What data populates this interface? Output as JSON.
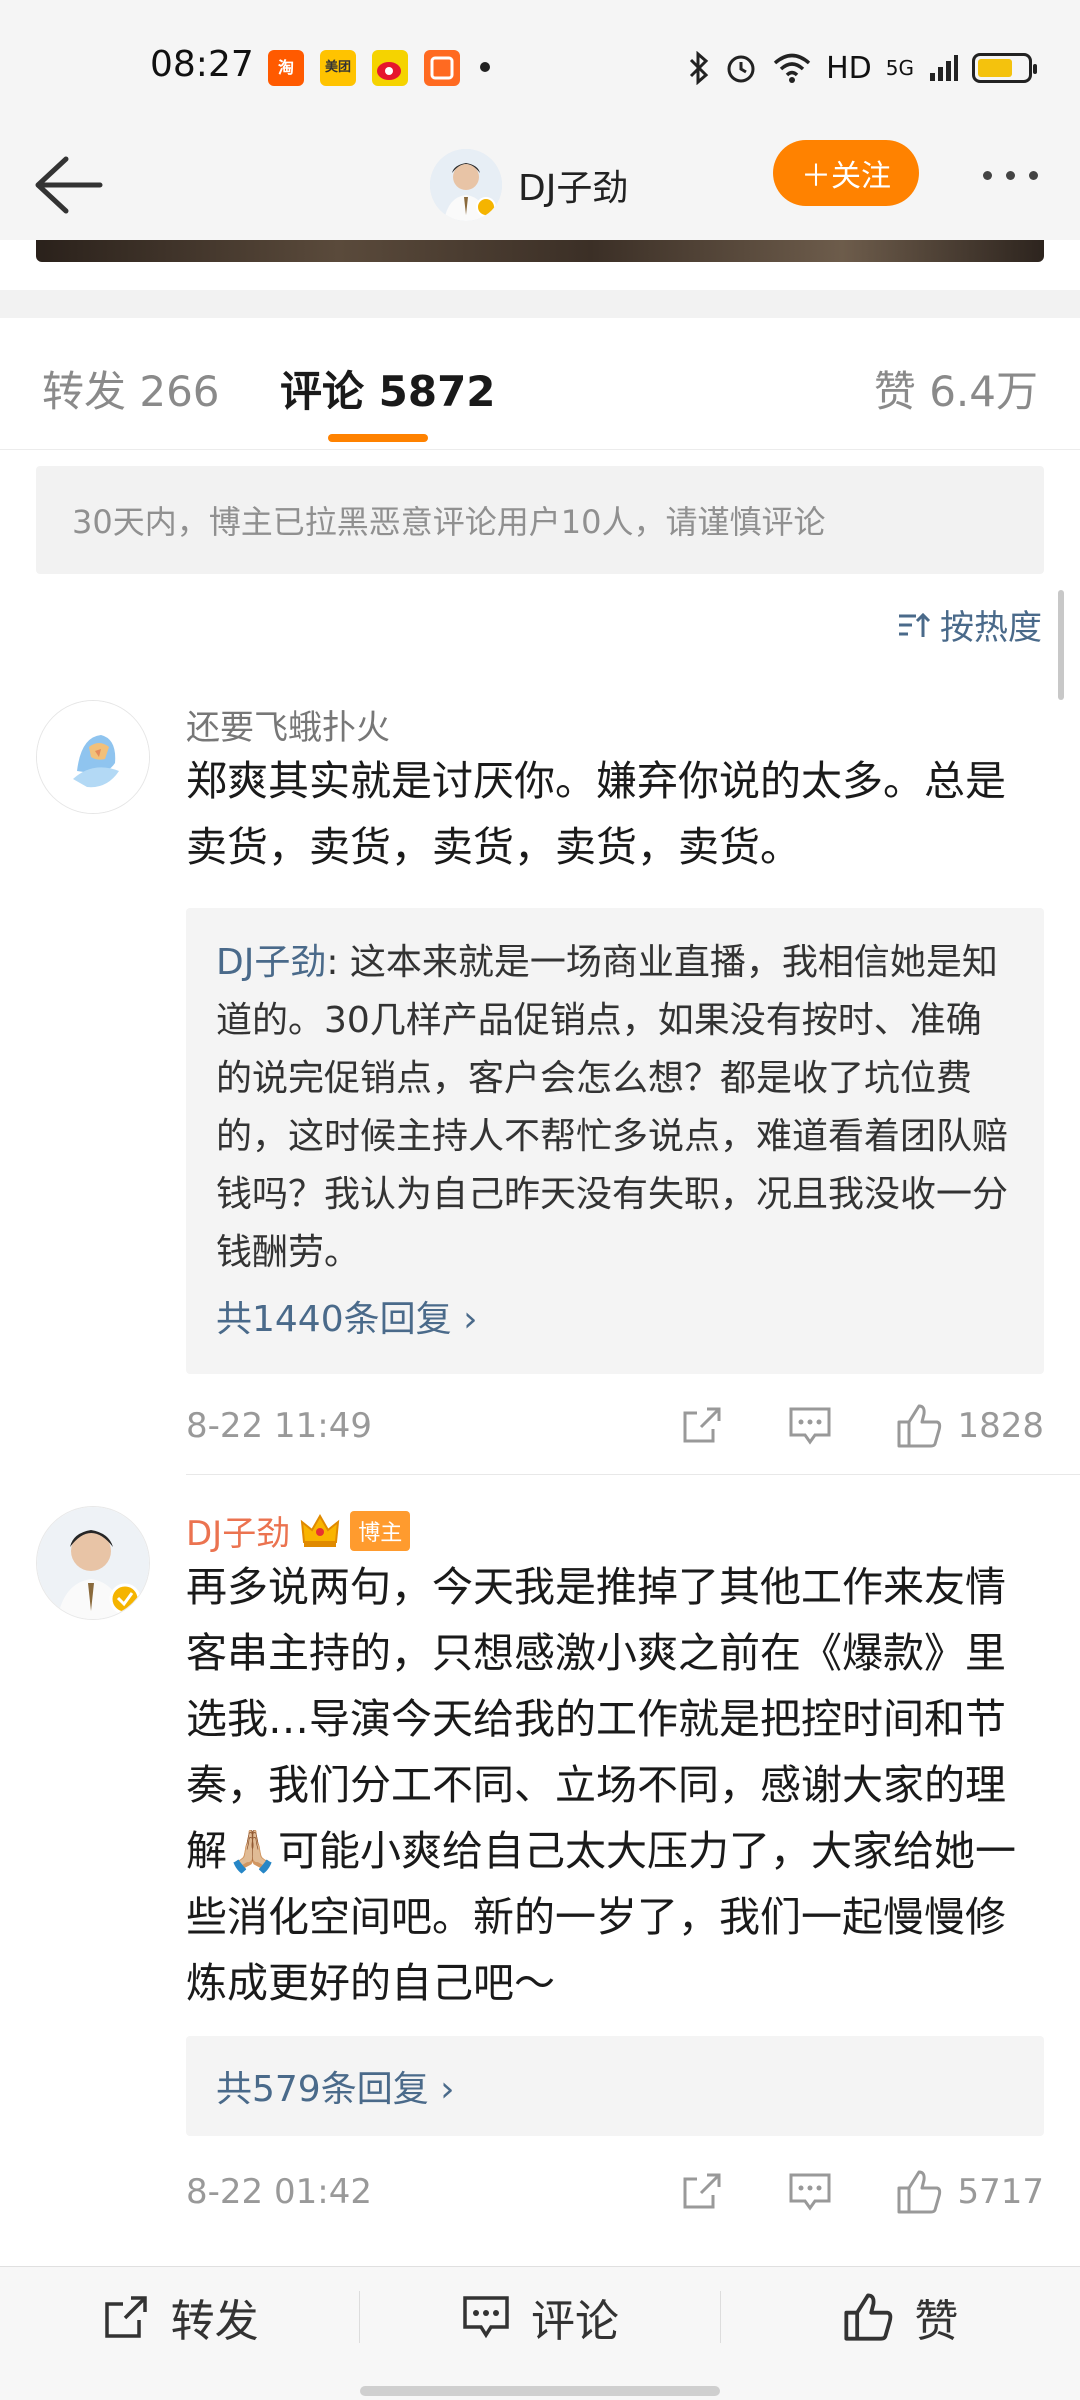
{
  "status_bar": {
    "time": "08:27",
    "notifications": [
      "淘",
      "美团",
      "微博",
      "app"
    ],
    "network": "HD",
    "signal": "5G"
  },
  "nav": {
    "title": "DJ子劲",
    "follow_label": "＋关注"
  },
  "tabs": {
    "repost": "转发 266",
    "comment": "评论 5872",
    "like": "赞 6.4万"
  },
  "notice": "30天内，博主已拉黑恶意评论用户10人，请谨慎评论",
  "sort_label": "按热度",
  "comments": [
    {
      "user": "还要飞蛾扑火",
      "text": "郑爽其实就是讨厌你。嫌弃你说的太多。总是卖货，卖货，卖货，卖货，卖货。",
      "reply": {
        "author": "DJ子劲",
        "text": ": 这本来就是一场商业直播，我相信她是知道的。30几样产品促销点，如果没有按时、准确的说完促销点，客户会怎么想？都是收了坑位费的，这时候主持人不帮忙多说点，难道看着团队赔钱吗？我认为自己昨天没有失职，况且我没收一分钱酬劳。",
        "more": "共1440条回复"
      },
      "time": "8-22 11:49",
      "likes": "1828"
    },
    {
      "user": "DJ子劲",
      "badge": "博主",
      "text": "再多说两句，今天我是推掉了其他工作来友情客串主持的，只想感激小爽之前在《爆款》里选我…导演今天给我的工作就是把控时间和节奏，我们分工不同、立场不同，感谢大家的理解🙏🏼可能小爽给自己太大压力了，大家给她一些消化空间吧。新的一岁了，我们一起慢慢修炼成更好的自己吧～",
      "reply_more": "共579条回复",
      "time": "8-22 01:42",
      "likes": "5717"
    }
  ],
  "bottom_bar": {
    "repost": "转发",
    "comment": "评论",
    "like": "赞"
  },
  "colors": {
    "accent": "#ff8200",
    "link": "#4a6a8a",
    "owner_name": "#eb7350"
  }
}
